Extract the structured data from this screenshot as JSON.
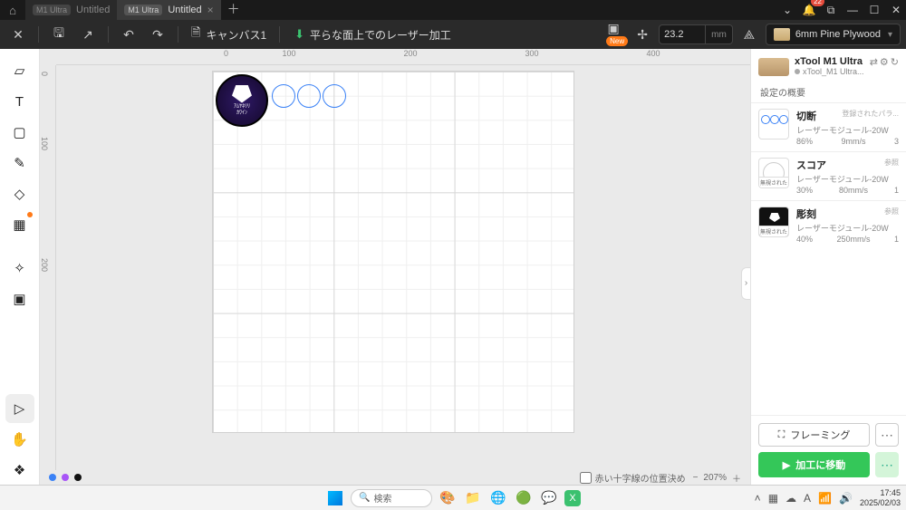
{
  "titlebar": {
    "tabs": [
      {
        "badge": "M1 Ultra",
        "label": "Untitled",
        "active": false
      },
      {
        "badge": "M1 Ultra",
        "label": "Untitled",
        "active": true
      }
    ],
    "notification_count": "22"
  },
  "toolbar": {
    "canvas_label": "キャンバス1",
    "mode_label": "平らな面上でのレーザー加工",
    "new_badge": "New",
    "thickness_value": "23.2",
    "thickness_unit": "mm",
    "material_name": "6mm Pine Plywood"
  },
  "ruler": {
    "h": [
      "0",
      "100",
      "200",
      "300",
      "400"
    ],
    "v": [
      "0",
      "100",
      "200"
    ]
  },
  "canvas_footer": {
    "colors": [
      "#3b82f6",
      "#a855f7",
      "#111111"
    ],
    "crosshair_label": "赤い十字線の位置決め",
    "zoom": "207%"
  },
  "right_panel": {
    "device_name": "xTool M1 Ultra",
    "device_sub": "xTool_M1 Ultra...",
    "settings_title": "設定の概要",
    "ignored_label": "無視された",
    "items": [
      {
        "type": "cut",
        "name": "切断",
        "meta": "登録されたパラ...",
        "module": "レーザーモジュール-20W",
        "power": "86%",
        "speed": "9mm/s",
        "count": "3"
      },
      {
        "type": "score",
        "name": "スコア",
        "meta": "参照",
        "module": "レーザーモジュール-20W",
        "power": "30%",
        "speed": "80mm/s",
        "count": "1"
      },
      {
        "type": "engrave",
        "name": "彫刻",
        "meta": "参照",
        "module": "レーザーモジュール-20W",
        "power": "40%",
        "speed": "250mm/s",
        "count": "1"
      }
    ],
    "framing_label": "フレーミング",
    "process_label": "加工に移動"
  },
  "taskbar": {
    "search_placeholder": "検索",
    "time": "17:45",
    "date": "2025/02/03"
  }
}
